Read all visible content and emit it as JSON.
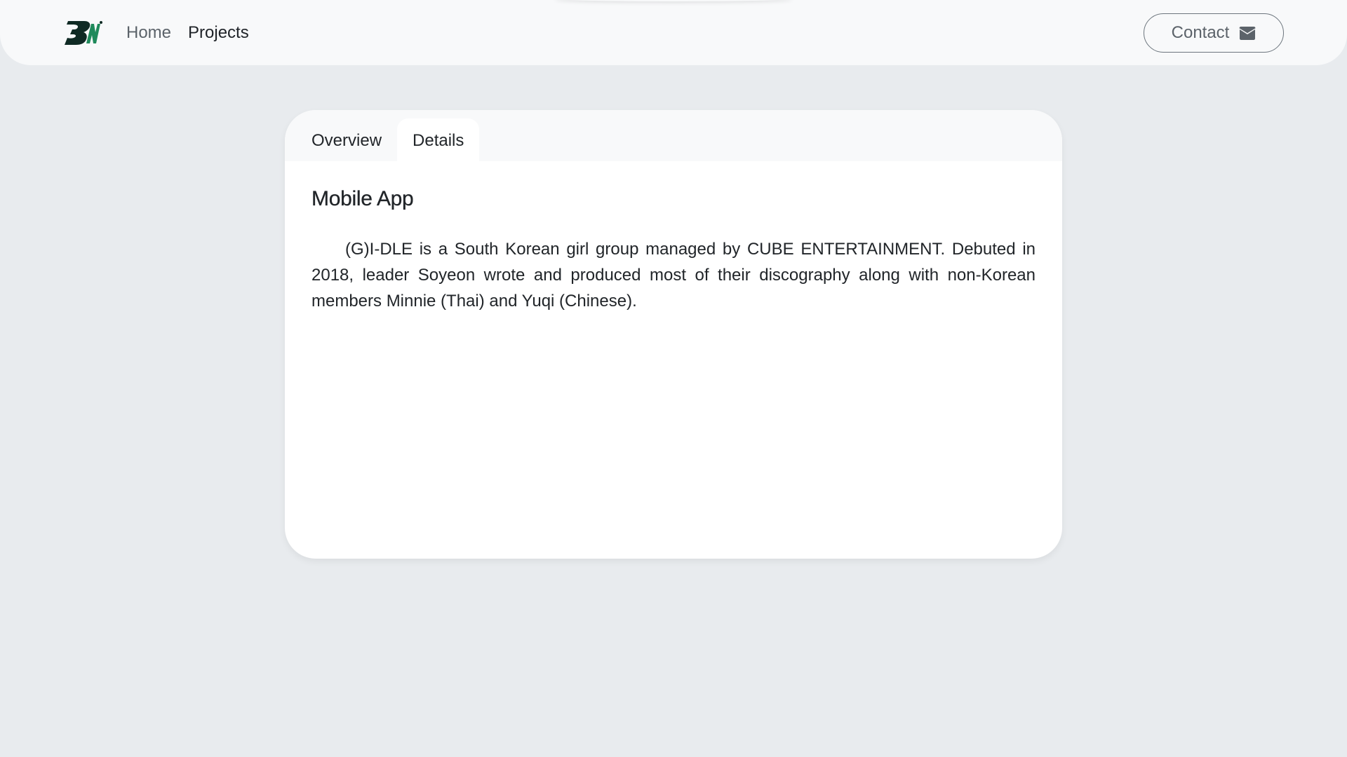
{
  "navbar": {
    "logo_name": "brand-logo",
    "links": [
      {
        "label": "Home",
        "active": false
      },
      {
        "label": "Projects",
        "active": true
      }
    ],
    "contact_label": "Contact",
    "contact_icon": "envelope-icon"
  },
  "card": {
    "tabs": [
      {
        "label": "Overview",
        "active": false
      },
      {
        "label": "Details",
        "active": true
      }
    ],
    "title": "Mobile App",
    "text": "(G)I-DLE is a South Korean girl group managed by CUBE ENTERTAINMENT. Debuted in 2018, leader Soyeon wrote and produced most of their discography along with non-Korean members Minnie (Thai) and Yuqi (Chinese)."
  },
  "colors": {
    "page_background": "#e8ebee",
    "navbar_background": "#f8f9fa",
    "logo_dark": "#0f2a24",
    "logo_accent": "#1f8a5b",
    "text": "#212529",
    "muted_text": "#5c636a"
  }
}
